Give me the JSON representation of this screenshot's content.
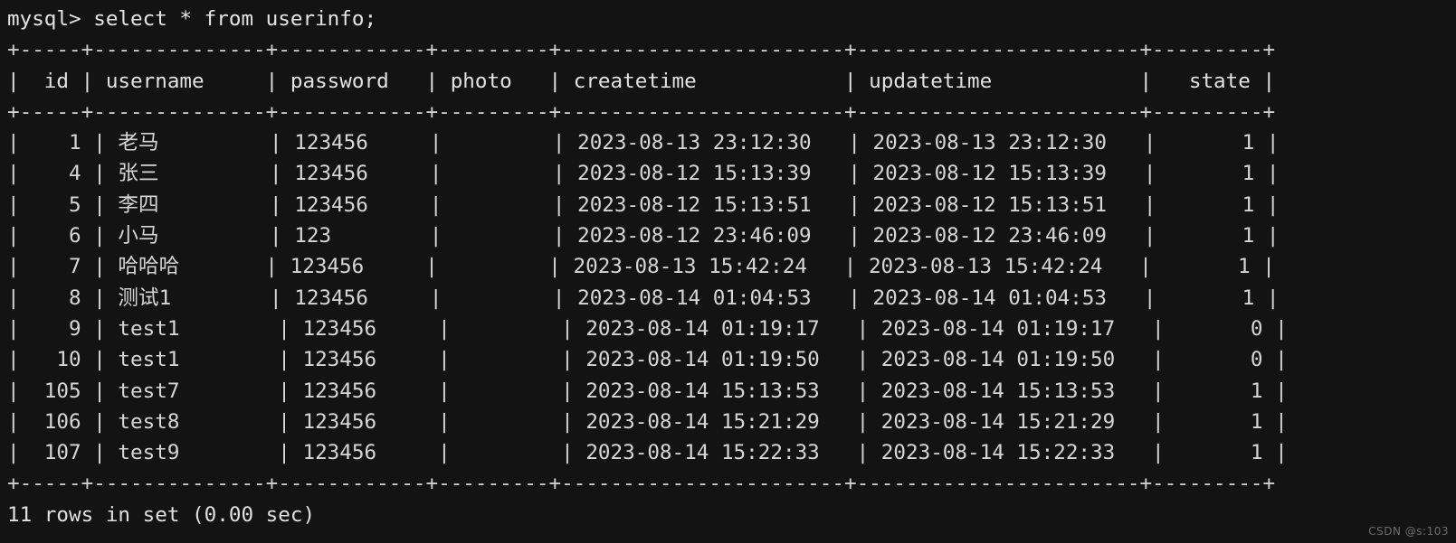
{
  "terminal": {
    "prompt": "mysql> ",
    "command": "select * from userinfo;",
    "prompt_line": "mysql> select * from userinfo;",
    "result_footer": "11 rows in set (0.00 sec)",
    "row_count": 11,
    "elapsed": "0.00 sec",
    "background_color": "#131313",
    "text_color": "#d8d8d8"
  },
  "watermark": {
    "text": "CSDN @s:103"
  },
  "table": {
    "name": "userinfo",
    "columns": [
      {
        "name": "id",
        "width": 4,
        "align": "right"
      },
      {
        "name": "username",
        "width": 12,
        "align": "left"
      },
      {
        "name": "password",
        "width": 10,
        "align": "left"
      },
      {
        "name": "photo",
        "width": 7,
        "align": "left"
      },
      {
        "name": "createtime",
        "width": 21,
        "align": "left"
      },
      {
        "name": "updatetime",
        "width": 21,
        "align": "left"
      },
      {
        "name": "state",
        "width": 7,
        "align": "right"
      }
    ],
    "separator": "+-----+--------------+------------+---------+-----------------------+-----------------------+---------+",
    "header_row": "|  id | username     | password   | photo   | createtime            | updatetime            |   state |",
    "rows": [
      {
        "id": "1",
        "username": "老马",
        "password": "123456",
        "photo": "",
        "createtime": "2023-08-13 23:12:30",
        "updatetime": "2023-08-13 23:12:30",
        "state": "1"
      },
      {
        "id": "4",
        "username": "张三",
        "password": "123456",
        "photo": "",
        "createtime": "2023-08-12 15:13:39",
        "updatetime": "2023-08-12 15:13:39",
        "state": "1"
      },
      {
        "id": "5",
        "username": "李四",
        "password": "123456",
        "photo": "",
        "createtime": "2023-08-12 15:13:51",
        "updatetime": "2023-08-12 15:13:51",
        "state": "1"
      },
      {
        "id": "6",
        "username": "小马",
        "password": "123",
        "photo": "",
        "createtime": "2023-08-12 23:46:09",
        "updatetime": "2023-08-12 23:46:09",
        "state": "1"
      },
      {
        "id": "7",
        "username": "哈哈哈",
        "password": "123456",
        "photo": "",
        "createtime": "2023-08-13 15:42:24",
        "updatetime": "2023-08-13 15:42:24",
        "state": "1"
      },
      {
        "id": "8",
        "username": "测试1",
        "password": "123456",
        "photo": "",
        "createtime": "2023-08-14 01:04:53",
        "updatetime": "2023-08-14 01:04:53",
        "state": "1"
      },
      {
        "id": "9",
        "username": "test1",
        "password": "123456",
        "photo": "",
        "createtime": "2023-08-14 01:19:17",
        "updatetime": "2023-08-14 01:19:17",
        "state": "0"
      },
      {
        "id": "10",
        "username": "test1",
        "password": "123456",
        "photo": "",
        "createtime": "2023-08-14 01:19:50",
        "updatetime": "2023-08-14 01:19:50",
        "state": "0"
      },
      {
        "id": "105",
        "username": "test7",
        "password": "123456",
        "photo": "",
        "createtime": "2023-08-14 15:13:53",
        "updatetime": "2023-08-14 15:13:53",
        "state": "1"
      },
      {
        "id": "106",
        "username": "test8",
        "password": "123456",
        "photo": "",
        "createtime": "2023-08-14 15:21:29",
        "updatetime": "2023-08-14 15:21:29",
        "state": "1"
      },
      {
        "id": "107",
        "username": "test9",
        "password": "123456",
        "photo": "",
        "createtime": "2023-08-14 15:22:33",
        "updatetime": "2023-08-14 15:22:33",
        "state": "1"
      }
    ]
  }
}
